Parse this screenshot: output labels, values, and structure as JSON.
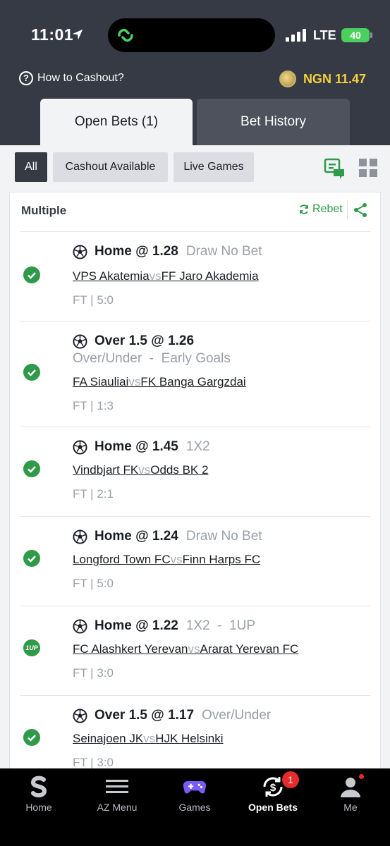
{
  "status_bar": {
    "time": "11:01",
    "network": "LTE",
    "battery": "40"
  },
  "header": {
    "how_to_cashout": "How to Cashout?",
    "balance": "NGN 11.47",
    "tabs": [
      {
        "label": "Open Bets (1)"
      },
      {
        "label": "Bet History"
      }
    ]
  },
  "filters": {
    "all": "All",
    "cashout": "Cashout Available",
    "live": "Live Games"
  },
  "card": {
    "title": "Multiple",
    "rebet": "Rebet",
    "selections": [
      {
        "pick": "Home @ 1.28",
        "market": "Draw No Bet",
        "home": "VPS Akatemia",
        "vs": "vs",
        "away": "FF Jaro Akademia",
        "result": "FT | 5:0",
        "status": "won"
      },
      {
        "pick": "Over 1.5 @ 1.26",
        "market": "Over/Under  -  Early Goals",
        "home": "FA Siauliai",
        "vs": "vs",
        "away": "FK Banga Gargzdai",
        "result": "FT | 1:3",
        "status": "won"
      },
      {
        "pick": "Home @ 1.45",
        "market": "1X2",
        "home": "Vindbjart FK",
        "vs": "vs",
        "away": "Odds BK 2",
        "result": "FT | 2:1",
        "status": "won"
      },
      {
        "pick": "Home @ 1.24",
        "market": "Draw No Bet",
        "home": "Longford Town FC",
        "vs": "vs",
        "away": "Finn Harps FC",
        "result": "FT | 5:0",
        "status": "won"
      },
      {
        "pick": "Home @ 1.22",
        "market": "1X2  -  1UP",
        "home": "FC Alashkert Yerevan",
        "vs": "vs",
        "away": "Ararat Yerevan FC",
        "result": "FT | 3:0",
        "status": "1up",
        "status_label": "1UP"
      },
      {
        "pick": "Over 1.5 @ 1.17",
        "market": "Over/Under",
        "home": "Seinajoen JK",
        "vs": "vs",
        "away": "HJK Helsinki",
        "result": "FT | 3:0",
        "status": "won"
      }
    ]
  },
  "bottom_nav": {
    "items": [
      {
        "label": "Home",
        "icon": "sporty-logo-icon"
      },
      {
        "label": "AZ Menu",
        "icon": "menu-icon"
      },
      {
        "label": "Games",
        "icon": "gamepad-icon"
      },
      {
        "label": "Open Bets",
        "icon": "open-bets-icon",
        "active": true
      },
      {
        "label": "Me",
        "icon": "user-icon"
      }
    ],
    "open_bets_badge": "1"
  },
  "colors": {
    "header_bg": "#353a45",
    "accent_green": "#2f9a4a",
    "balance_yellow": "#f5d13a",
    "badge_red": "#e52b2b"
  }
}
